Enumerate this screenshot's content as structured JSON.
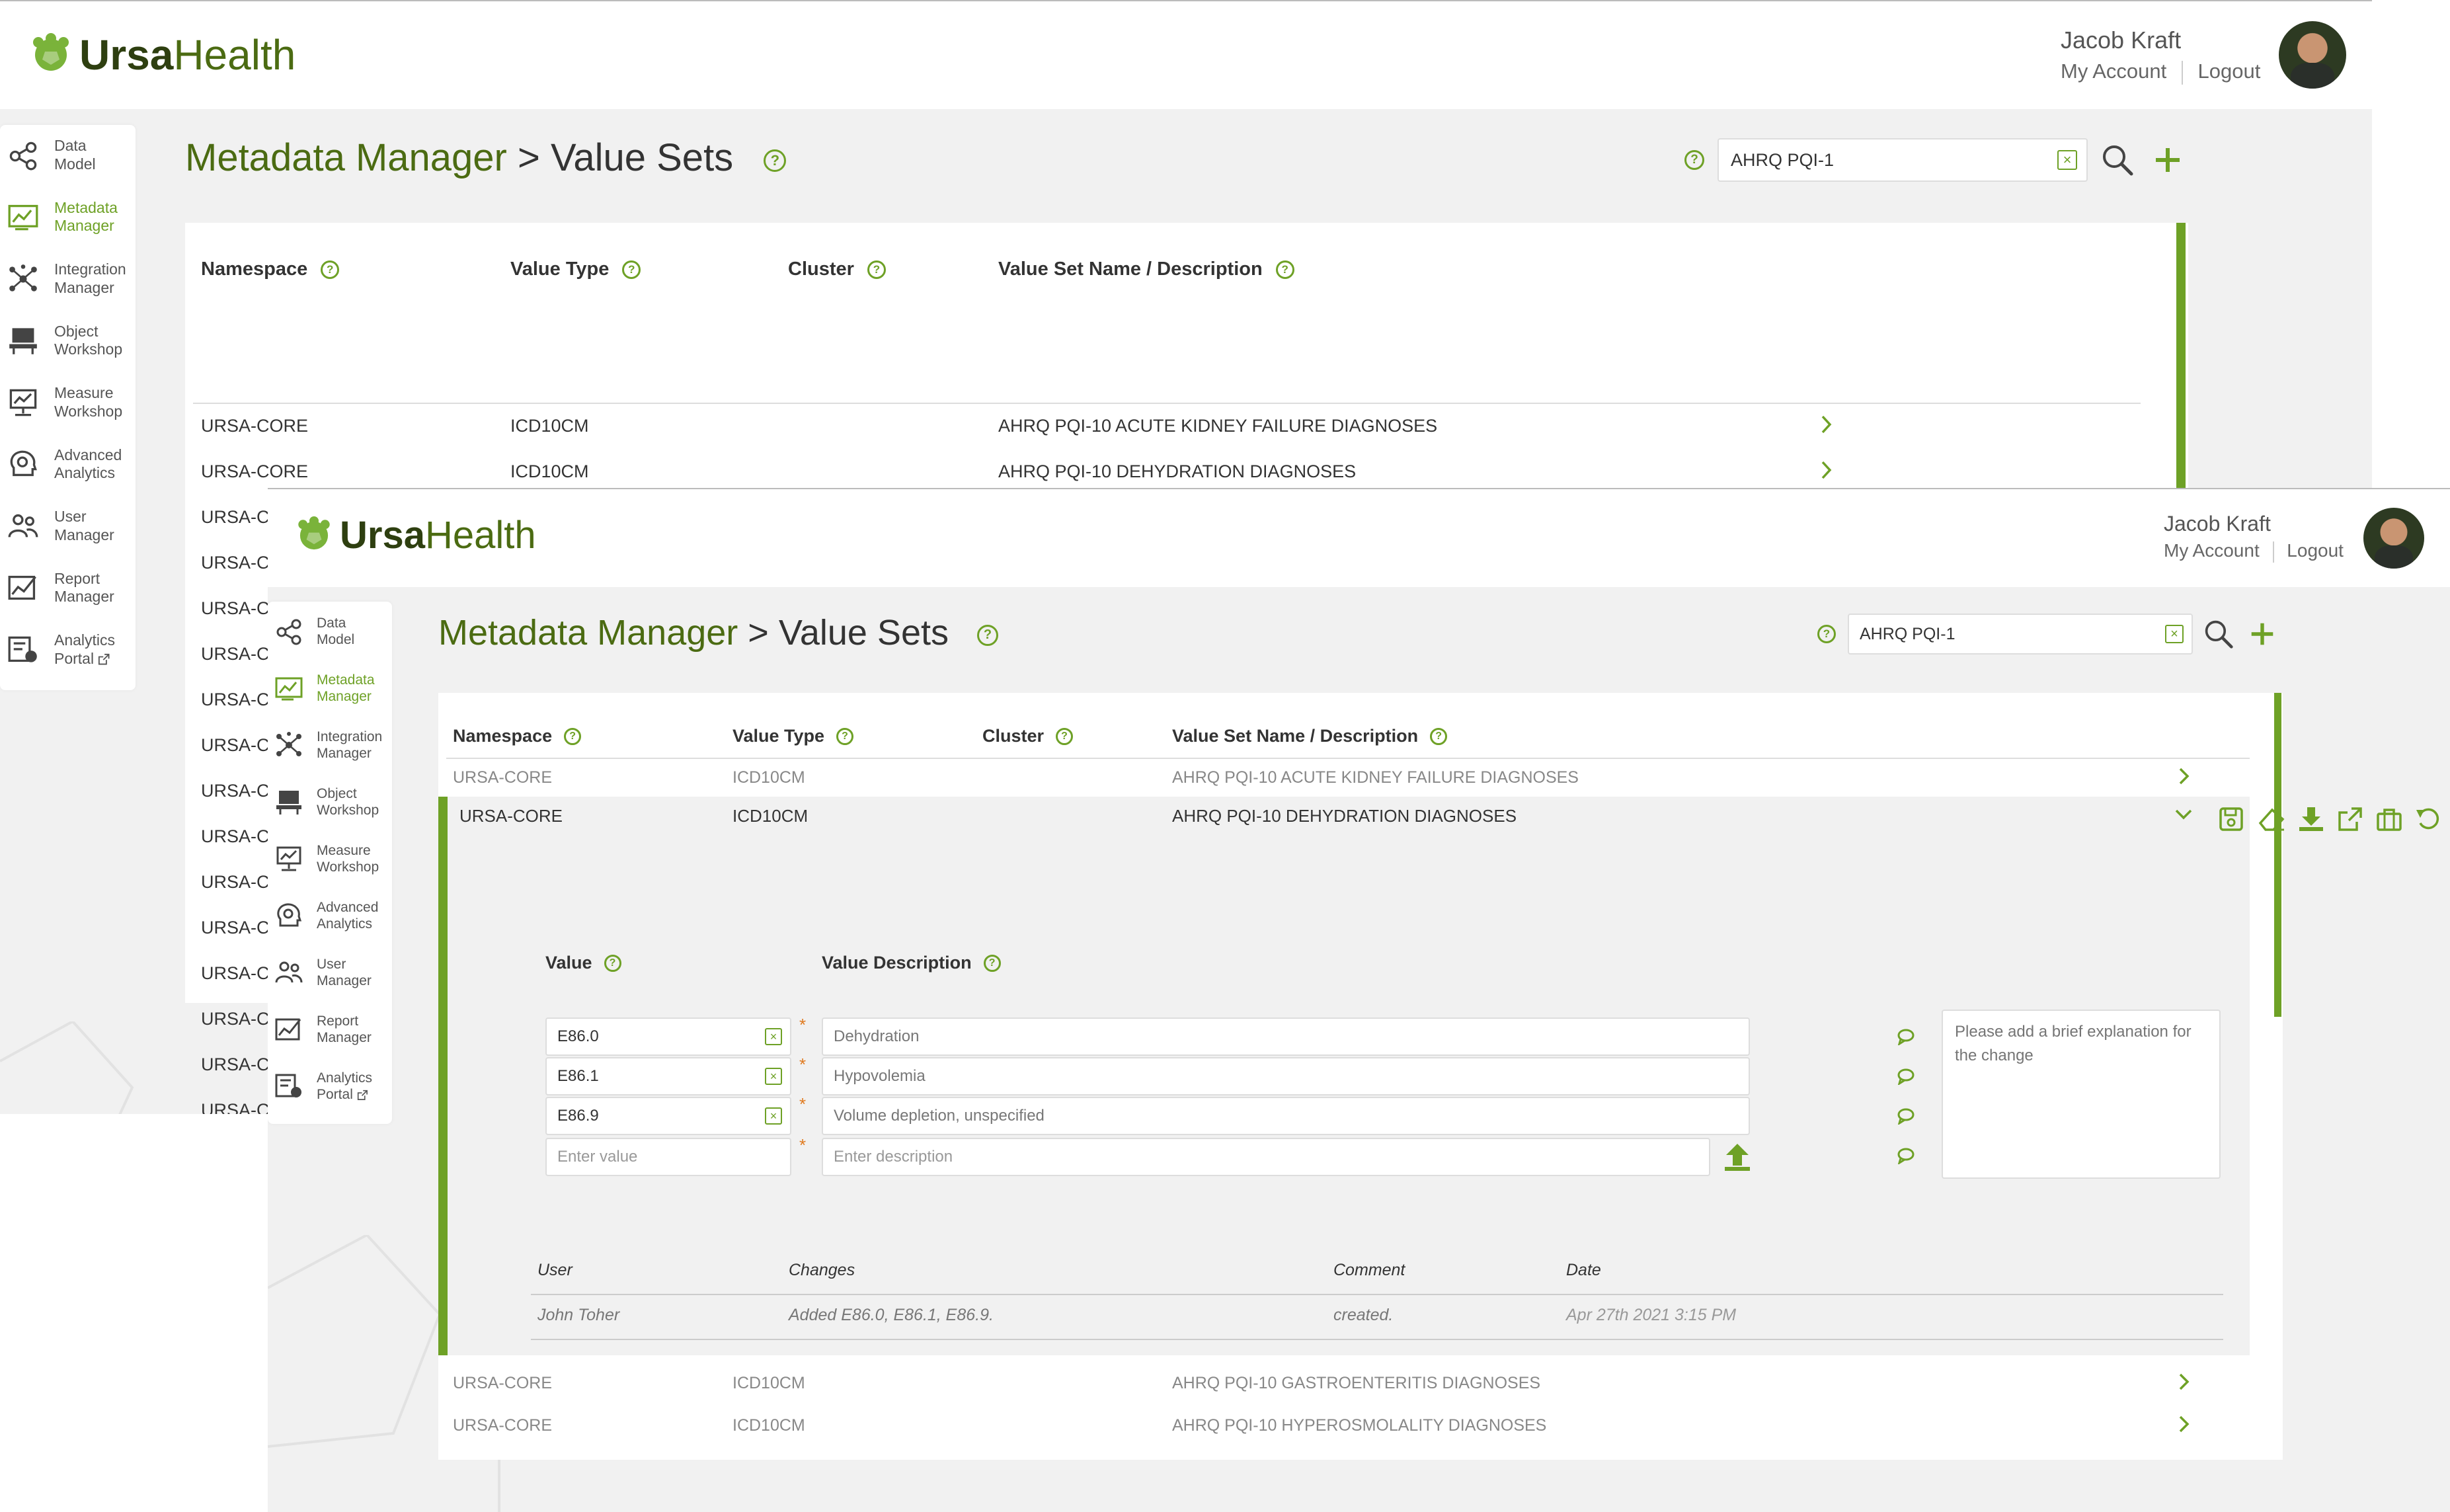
{
  "app": {
    "logo_bold": "Ursa",
    "logo_light": "Health"
  },
  "user": {
    "name": "Jacob Kraft",
    "my_account": "My Account",
    "logout": "Logout"
  },
  "sidebar": {
    "items": [
      {
        "line1": "Data",
        "line2": "Model",
        "icon": "share-nodes-icon"
      },
      {
        "line1": "Metadata",
        "line2": "Manager",
        "icon": "chart-edit-icon",
        "active": true
      },
      {
        "line1": "Integration",
        "line2": "Manager",
        "icon": "network-icon"
      },
      {
        "line1": "Object",
        "line2": "Workshop",
        "icon": "desk-icon"
      },
      {
        "line1": "Measure",
        "line2": "Workshop",
        "icon": "monitor-icon"
      },
      {
        "line1": "Advanced",
        "line2": "Analytics",
        "icon": "head-gear-icon"
      },
      {
        "line1": "User",
        "line2": "Manager",
        "icon": "users-icon"
      },
      {
        "line1": "Report",
        "line2": "Manager",
        "icon": "report-chart-icon"
      },
      {
        "line1": "Analytics",
        "line2": "Portal",
        "icon": "portal-icon"
      }
    ]
  },
  "page": {
    "title_part1": "Metadata Manager",
    "title_sep": " > ",
    "title_part2": "Value Sets",
    "search_value": "AHRQ PQI-1"
  },
  "table": {
    "headers": {
      "namespace": "Namespace",
      "value_type": "Value Type",
      "cluster": "Cluster",
      "name": "Value Set Name / Description"
    },
    "rows": [
      {
        "namespace": "URSA-CORE",
        "value_type": "ICD10CM",
        "cluster": "",
        "name": "AHRQ PQI-10 ACUTE KIDNEY FAILURE DIAGNOSES"
      },
      {
        "namespace": "URSA-CORE",
        "value_type": "ICD10CM",
        "cluster": "",
        "name": "AHRQ PQI-10 DEHYDRATION DIAGNOSES"
      },
      {
        "namespace": "URSA-CORE",
        "value_type": "ICD10CM",
        "cluster": "",
        "name": "AHRQ PQI-10 GASTROENTERITIS DIAGNOSES"
      },
      {
        "namespace": "URSA-CORE",
        "value_type": "ICD10CM",
        "cluster": "",
        "name": "AHRQ PQI-10 HYPEROSMOLALITY DIAGNOSES"
      }
    ],
    "truncated_namespace": "URSA-C("
  },
  "editor": {
    "value_header": "Value",
    "desc_header": "Value Description",
    "values": [
      {
        "value": "E86.0",
        "description": "Dehydration"
      },
      {
        "value": "E86.1",
        "description": "Hypovolemia"
      },
      {
        "value": "E86.9",
        "description": "Volume depletion, unspecified"
      }
    ],
    "new_value_placeholder": "Enter value",
    "new_desc_placeholder": "Enter description",
    "comment_placeholder": "Please add a brief explanation for the change",
    "required_mark": "*"
  },
  "history": {
    "headers": {
      "user": "User",
      "changes": "Changes",
      "comment": "Comment",
      "date": "Date"
    },
    "rows": [
      {
        "user": "John Toher",
        "changes": "Added E86.0, E86.1, E86.9.",
        "comment": "created.",
        "date": "Apr 27th 2021 3:15 PM"
      }
    ]
  },
  "help_glyph": "?",
  "clear_glyph": "×",
  "colors": {
    "brand_green": "#6ea126",
    "dark_green": "#4b6b12",
    "trash_red": "#9b1b1b",
    "background": "#f1f1f1"
  }
}
